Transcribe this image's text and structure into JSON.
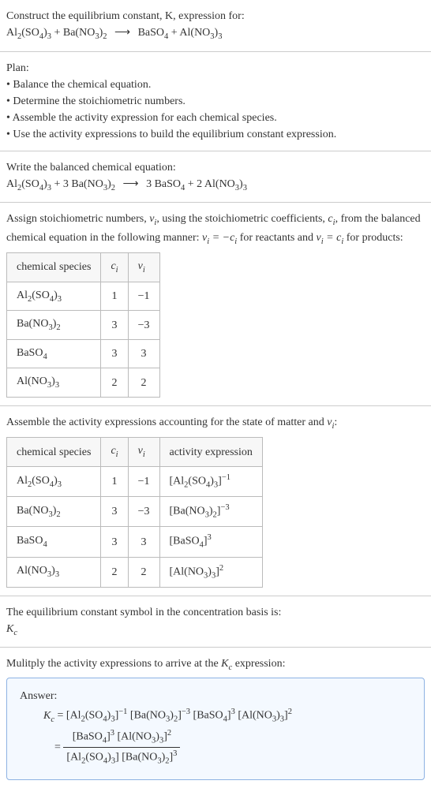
{
  "header": {
    "line1": "Construct the equilibrium constant, K, expression for:",
    "equation": "Al₂(SO₄)₃ + Ba(NO₃)₂ ⟶ BaSO₄ + Al(NO₃)₃"
  },
  "plan": {
    "title": "Plan:",
    "bullets": [
      "Balance the chemical equation.",
      "Determine the stoichiometric numbers.",
      "Assemble the activity expression for each chemical species.",
      "Use the activity expressions to build the equilibrium constant expression."
    ]
  },
  "balanced": {
    "title": "Write the balanced chemical equation:",
    "equation": "Al₂(SO₄)₃ + 3 Ba(NO₃)₂ ⟶ 3 BaSO₄ + 2 Al(NO₃)₃"
  },
  "stoich": {
    "intro_pre": "Assign stoichiometric numbers, ",
    "intro_mid1": ", using the stoichiometric coefficients, ",
    "intro_mid2": ", from the balanced chemical equation in the following manner: ",
    "intro_eq1": "νᵢ = −cᵢ",
    "intro_mid3": " for reactants and ",
    "intro_eq2": "νᵢ = cᵢ",
    "intro_end": " for products:",
    "headers": [
      "chemical species",
      "cᵢ",
      "νᵢ"
    ],
    "rows": [
      [
        "Al₂(SO₄)₃",
        "1",
        "−1"
      ],
      [
        "Ba(NO₃)₂",
        "3",
        "−3"
      ],
      [
        "BaSO₄",
        "3",
        "3"
      ],
      [
        "Al(NO₃)₃",
        "2",
        "2"
      ]
    ]
  },
  "activity": {
    "intro": "Assemble the activity expressions accounting for the state of matter and νᵢ:",
    "headers": [
      "chemical species",
      "cᵢ",
      "νᵢ",
      "activity expression"
    ],
    "rows": [
      [
        "Al₂(SO₄)₃",
        "1",
        "−1",
        "[Al₂(SO₄)₃]⁻¹"
      ],
      [
        "Ba(NO₃)₂",
        "3",
        "−3",
        "[Ba(NO₃)₂]⁻³"
      ],
      [
        "BaSO₄",
        "3",
        "3",
        "[BaSO₄]³"
      ],
      [
        "Al(NO₃)₃",
        "2",
        "2",
        "[Al(NO₃)₃]²"
      ]
    ]
  },
  "symbol": {
    "line": "The equilibrium constant symbol in the concentration basis is:",
    "kc": "K𝒸"
  },
  "multiply": {
    "line": "Mulitply the activity expressions to arrive at the K𝒸 expression:"
  },
  "answer": {
    "label": "Answer:",
    "line1": "K𝒸 = [Al₂(SO₄)₃]⁻¹ [Ba(NO₃)₂]⁻³ [BaSO₄]³ [Al(NO₃)₃]²",
    "eq": "=",
    "num": "[BaSO₄]³ [Al(NO₃)₃]²",
    "den": "[Al₂(SO₄)₃] [Ba(NO₃)₂]³"
  }
}
